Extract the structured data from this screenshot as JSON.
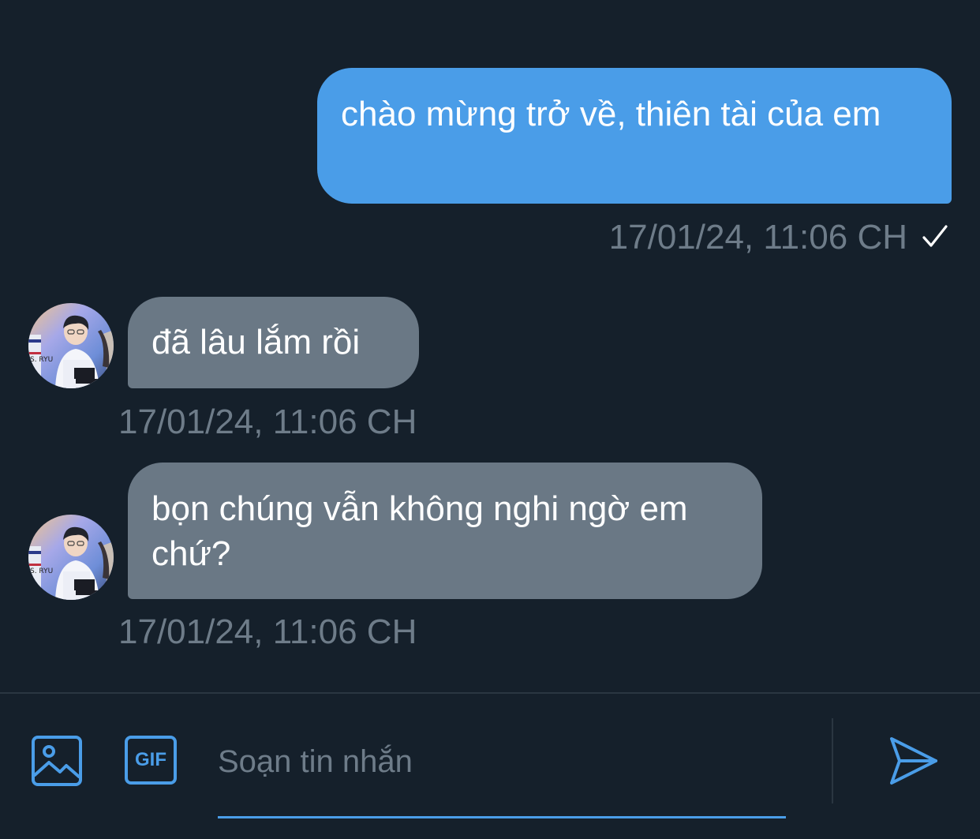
{
  "colors": {
    "background": "#15202b",
    "outgoing_bubble": "#4a9de8",
    "incoming_bubble": "#6a7885",
    "timestamp": "#6e7c89",
    "accent": "#4a9de8"
  },
  "messages": [
    {
      "direction": "outgoing",
      "text": "chào mừng trở về, thiên tài của em",
      "timestamp": "17/01/24, 11:06 CH",
      "status_icon": "checkmark-icon"
    },
    {
      "direction": "incoming",
      "text": "đã lâu lắm rồi",
      "timestamp": "17/01/24, 11:06 CH",
      "avatar_icon": "avatar"
    },
    {
      "direction": "incoming",
      "text": "bọn chúng vẫn không nghi ngờ em chứ?",
      "timestamp": "17/01/24, 11:06 CH",
      "avatar_icon": "avatar"
    }
  ],
  "composer": {
    "placeholder": "Soạn tin nhắn",
    "value": "",
    "image_icon": "image-icon",
    "gif_icon": "gif-icon",
    "gif_label": "GIF",
    "send_icon": "send-icon"
  }
}
